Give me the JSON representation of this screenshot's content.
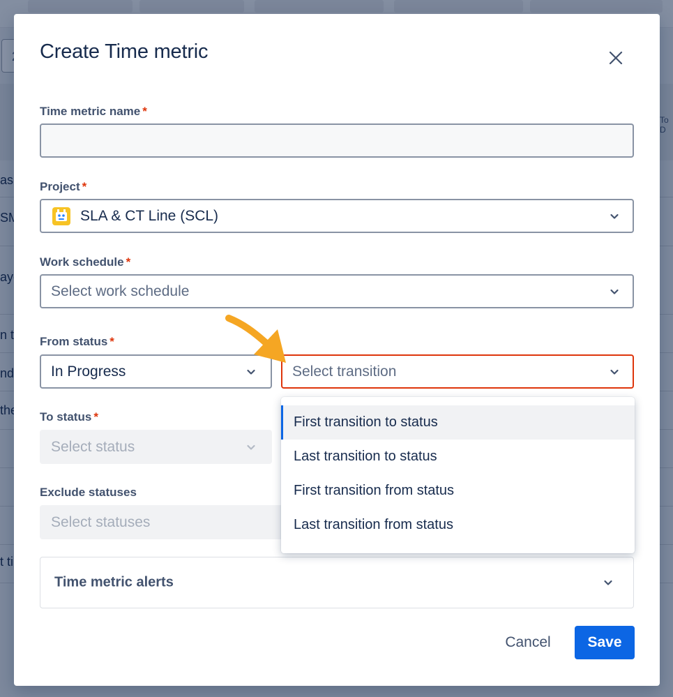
{
  "background": {
    "partial_texts": [
      "as",
      "SM",
      "aye",
      "n t",
      "nd",
      "the",
      "t ti"
    ],
    "input_value": "2",
    "right_header_text": "To D"
  },
  "modal": {
    "title": "Create Time metric",
    "close_icon": "close-icon",
    "fields": {
      "time_metric_name": {
        "label": "Time metric name",
        "value": ""
      },
      "project": {
        "label": "Project",
        "value": "SLA & CT Line (SCL)",
        "icon": "project-avatar-icon"
      },
      "work_schedule": {
        "label": "Work schedule",
        "placeholder": "Select work schedule"
      },
      "from_status": {
        "label": "From status",
        "value": "In Progress",
        "transition_placeholder": "Select transition"
      },
      "to_status": {
        "label": "To status",
        "placeholder": "Select status"
      },
      "exclude_statuses": {
        "label": "Exclude statuses",
        "placeholder": "Select statuses"
      }
    },
    "required_marker": "*",
    "transition_menu": {
      "options": [
        "First transition to status",
        "Last transition to status",
        "First transition from status",
        "Last transition from status"
      ],
      "highlighted_index": 0
    },
    "alerts_section": {
      "label": "Time metric alerts"
    },
    "buttons": {
      "cancel": "Cancel",
      "save": "Save"
    }
  },
  "colors": {
    "primary": "#0c66e4",
    "error": "#de350b",
    "annotation_arrow": "#f5a623",
    "text": "#172b4d",
    "muted": "#42526e"
  }
}
